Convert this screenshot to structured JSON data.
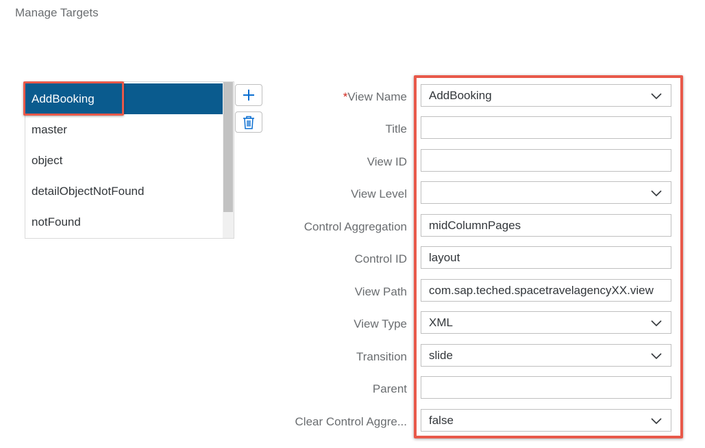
{
  "page": {
    "title": "Manage Targets"
  },
  "targets": {
    "items": [
      {
        "label": "AddBooking",
        "selected": true
      },
      {
        "label": "master",
        "selected": false
      },
      {
        "label": "object",
        "selected": false
      },
      {
        "label": "detailObjectNotFound",
        "selected": false
      },
      {
        "label": "notFound",
        "selected": false
      }
    ],
    "add_icon": "plus-icon",
    "delete_icon": "trash-icon"
  },
  "form": {
    "required_marker": "*",
    "fields": [
      {
        "label": "View Name",
        "value": "AddBooking",
        "type": "select",
        "required": true
      },
      {
        "label": "Title",
        "value": "",
        "type": "text"
      },
      {
        "label": "View ID",
        "value": "",
        "type": "text"
      },
      {
        "label": "View Level",
        "value": "",
        "type": "select"
      },
      {
        "label": "Control Aggregation",
        "value": "midColumnPages",
        "type": "text"
      },
      {
        "label": "Control ID",
        "value": "layout",
        "type": "text"
      },
      {
        "label": "View Path",
        "value": "com.sap.teched.spacetravelagencyXX.view",
        "type": "text"
      },
      {
        "label": "View Type",
        "value": "XML",
        "type": "select"
      },
      {
        "label": "Transition",
        "value": "slide",
        "type": "select"
      },
      {
        "label": "Parent",
        "value": "",
        "type": "text"
      },
      {
        "label": "Clear Control Aggre...",
        "value": "false",
        "type": "select"
      }
    ]
  },
  "colors": {
    "selected_bg": "#0a5b8e",
    "highlight": "#e8594a",
    "required": "#d0271d"
  }
}
